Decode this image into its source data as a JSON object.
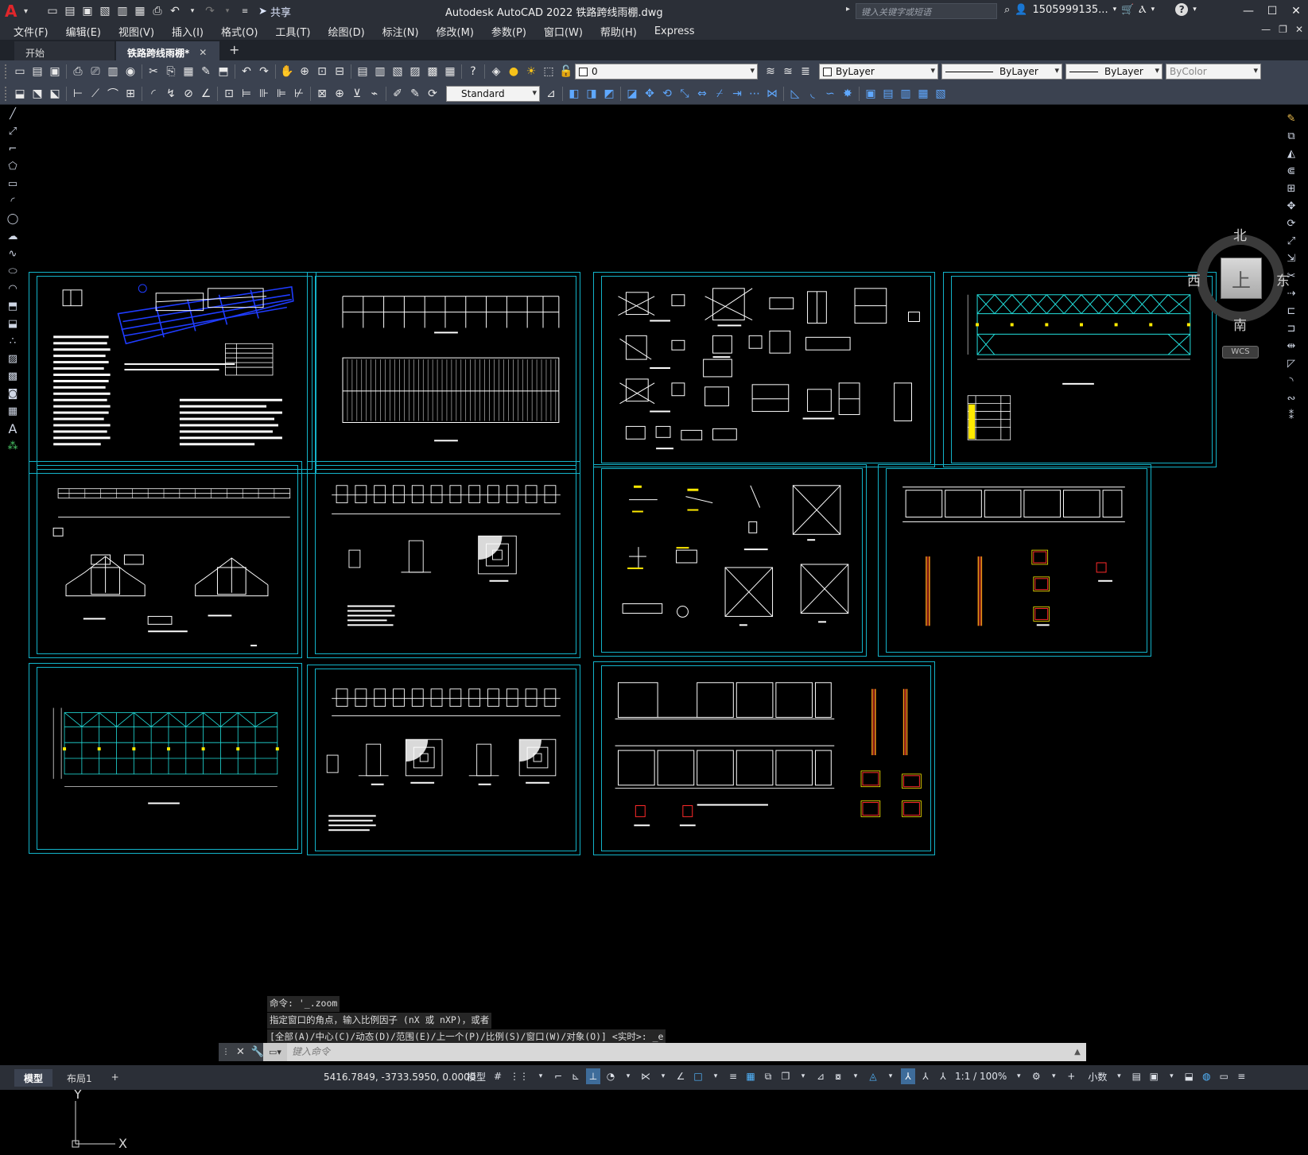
{
  "app": {
    "logo_letter": "A",
    "title": "Autodesk AutoCAD 2022    铁路跨线雨棚.dwg",
    "share_label": "共享",
    "search_placeholder": "键入关键字或短语",
    "user_name": "1505999135...",
    "help_label": "?"
  },
  "menu": [
    "文件(F)",
    "编辑(E)",
    "视图(V)",
    "插入(I)",
    "格式(O)",
    "工具(T)",
    "绘图(D)",
    "标注(N)",
    "修改(M)",
    "参数(P)",
    "窗口(W)",
    "帮助(H)",
    "Express"
  ],
  "doc_tabs": [
    {
      "label": "开始"
    },
    {
      "label": "铁路跨线雨棚*",
      "close": "✕"
    }
  ],
  "doc_tab_add": "+",
  "toolbar": {
    "layer_value": "0",
    "color_value": "ByLayer",
    "linetype_value": "ByLayer",
    "lineweight_value": "ByLayer",
    "plotstyle_value": "ByColor",
    "textstyle_value": "Standard"
  },
  "viewcube": {
    "top_face": "上",
    "north": "北",
    "south": "南",
    "east": "东",
    "west": "西",
    "wcs": "WCS"
  },
  "ucs": {
    "x": "X",
    "y": "Y"
  },
  "command": {
    "history": [
      "命令: '_.zoom",
      "指定窗口的角点，输入比例因子 (nX 或 nXP)，或者",
      "[全部(A)/中心(C)/动态(D)/范围(E)/上一个(P)/比例(S)/窗口(W)/对象(O)] <实时>: _e"
    ],
    "placeholder": "键入命令",
    "close_icon": "✕"
  },
  "status": {
    "layout_tabs": [
      "模型",
      "布局1"
    ],
    "add_tab": "+",
    "coordinates": "5416.7849, -3733.5950, 0.0000",
    "model_label": "模型",
    "scale": "1:1 / 100%",
    "units": "小数"
  },
  "colors": {
    "frame": "#13b3c9",
    "background": "#000000",
    "chrome": "#2b2f37",
    "toolbar": "#3b4250"
  }
}
